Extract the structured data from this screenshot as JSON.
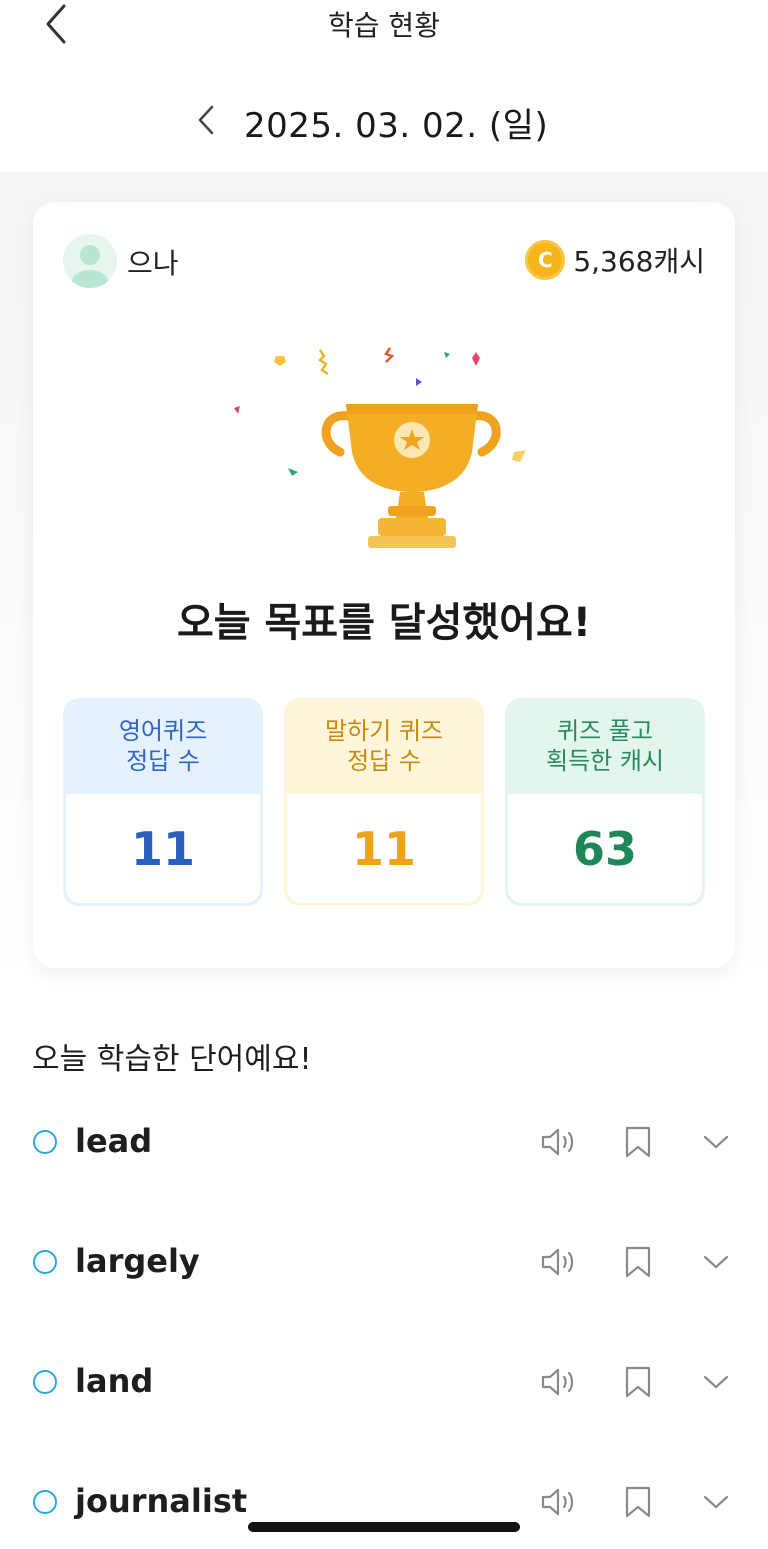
{
  "header": {
    "title": "학습 현황"
  },
  "date": {
    "label": "2025. 03. 02. (일)"
  },
  "card": {
    "username": "으나",
    "cash": "5,368캐시",
    "goal_title": "오늘 목표를 달성했어요!",
    "stats": [
      {
        "line1": "영어퀴즈",
        "line2": "정답 수",
        "value": "11"
      },
      {
        "line1": "말하기 퀴즈",
        "line2": "정답 수",
        "value": "11"
      },
      {
        "line1": "퀴즈 풀고",
        "line2": "획득한 캐시",
        "value": "63"
      }
    ]
  },
  "words": {
    "title": "오늘 학습한 단어예요!",
    "items": [
      {
        "word": "lead"
      },
      {
        "word": "largely"
      },
      {
        "word": "land"
      },
      {
        "word": "journalist"
      }
    ]
  },
  "colors": {
    "accent_blue": "#2a5fbf",
    "accent_orange": "#efa21a",
    "accent_green": "#1e8758",
    "check_circle": "#2aa7e0"
  }
}
